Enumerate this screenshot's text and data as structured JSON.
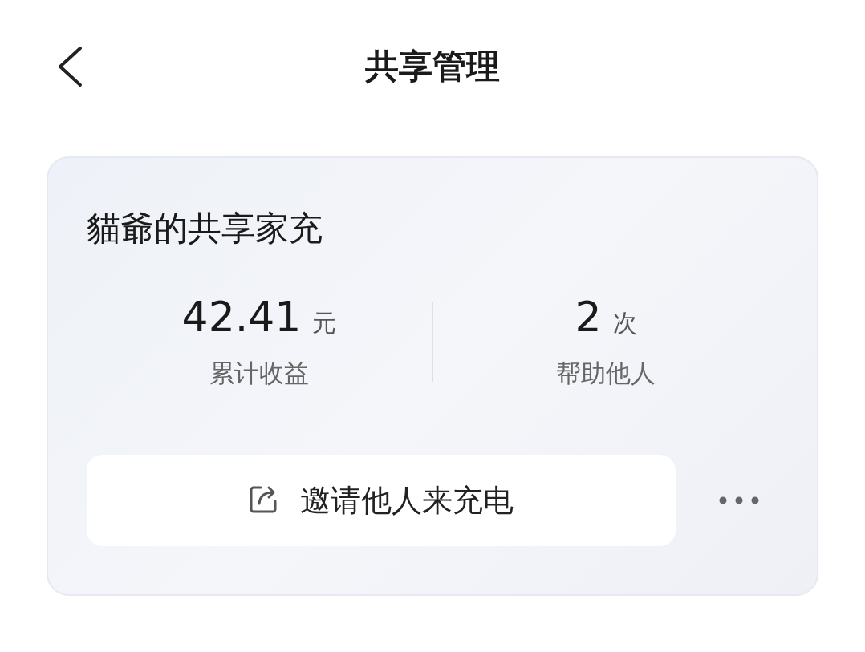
{
  "header": {
    "title": "共享管理"
  },
  "card": {
    "title": "貓爺的共享家充",
    "stats": [
      {
        "value": "42.41",
        "unit": "元",
        "label": "累计收益"
      },
      {
        "value": "2",
        "unit": "次",
        "label": "帮助他人"
      }
    ],
    "invite_button": {
      "label": "邀请他人来充电"
    }
  }
}
